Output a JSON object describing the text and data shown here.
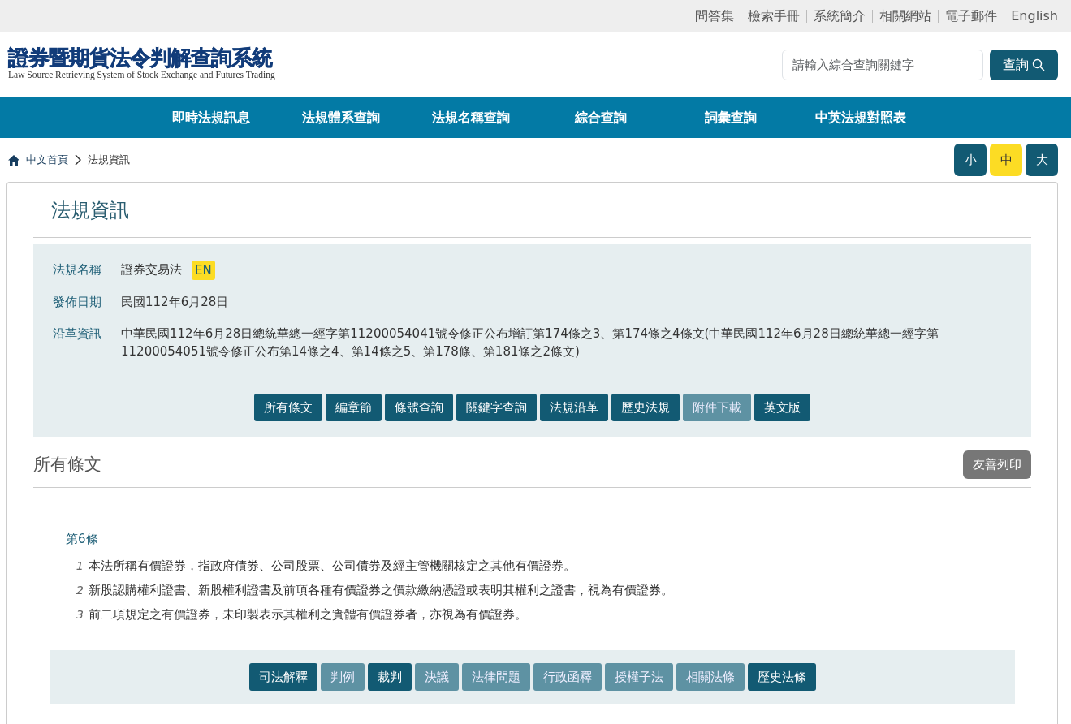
{
  "top_links": [
    "問答集",
    "檢索手冊",
    "系統簡介",
    "相關網站",
    "電子郵件",
    "English"
  ],
  "logo": {
    "title": "證券暨期貨法令判解查詢系統",
    "subtitle": "Law Source Retrieving System of Stock Exchange and Futures Trading"
  },
  "search": {
    "placeholder": "請輸入綜合查詢關鍵字",
    "button": "查詢"
  },
  "nav": [
    "即時法規訊息",
    "法規體系查詢",
    "法規名稱查詢",
    "綜合查詢",
    "詞彙查詢",
    "中英法規對照表"
  ],
  "breadcrumb": [
    "中文首頁",
    "法規資訊"
  ],
  "font_sizes": [
    {
      "label": "小",
      "selected": false
    },
    {
      "label": "中",
      "selected": true
    },
    {
      "label": "大",
      "selected": false
    }
  ],
  "page_title": "法規資訊",
  "info": [
    {
      "label": "法規名稱",
      "value": "證券交易法",
      "badge": "EN"
    },
    {
      "label": "發佈日期",
      "value": "民國112年6月28日"
    },
    {
      "label": "沿革資訊",
      "value": "中華民國112年6月28日總統華總一經字第11200054041號令修正公布增訂第174條之3、第174條之4條文(中華民國112年6月28日總統華總一經字第11200054051號令修正公布第14條之4、第14條之5、第178條、第181條之2條文)"
    }
  ],
  "law_buttons": [
    {
      "label": "所有條文",
      "disabled": false
    },
    {
      "label": "編章節",
      "disabled": false
    },
    {
      "label": "條號查詢",
      "disabled": false
    },
    {
      "label": "關鍵字查詢",
      "disabled": false
    },
    {
      "label": "法規沿革",
      "disabled": false
    },
    {
      "label": "歷史法規",
      "disabled": false
    },
    {
      "label": "附件下載",
      "disabled": true
    },
    {
      "label": "英文版",
      "disabled": false
    }
  ],
  "section_title": "所有條文",
  "print_button": "友善列印",
  "article": {
    "title": "第6條",
    "paragraphs": [
      {
        "number": "1",
        "text": "本法所稱有價證券，指政府債券、公司股票、公司債券及經主管機關核定之其他有價證券。"
      },
      {
        "number": "2",
        "text": "新股認購權利證書、新股權利證書及前項各種有價證券之價款繳納憑證或表明其權利之證書，視為有價證券。"
      },
      {
        "number": "3",
        "text": "前二項規定之有價證券，未印製表示其權利之實體有價證券者，亦視為有價證券。"
      }
    ]
  },
  "article_buttons": [
    {
      "label": "司法解釋",
      "disabled": false
    },
    {
      "label": "判例",
      "disabled": true
    },
    {
      "label": "裁判",
      "disabled": false
    },
    {
      "label": "決議",
      "disabled": true
    },
    {
      "label": "法律問題",
      "disabled": true
    },
    {
      "label": "行政函釋",
      "disabled": true
    },
    {
      "label": "授權子法",
      "disabled": true
    },
    {
      "label": "相關法條",
      "disabled": true
    },
    {
      "label": "歷史法條",
      "disabled": false
    }
  ]
}
